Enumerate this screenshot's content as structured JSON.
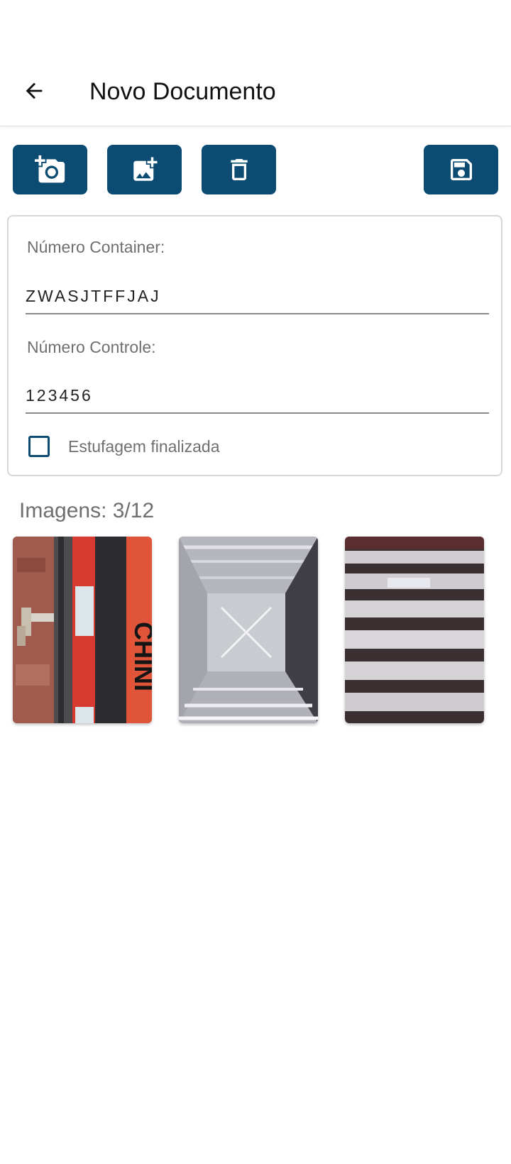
{
  "header": {
    "title": "Novo Documento",
    "back_icon": "arrow-back-icon"
  },
  "toolbar": {
    "color": "#0d4c72",
    "buttons": [
      {
        "icon": "add-camera-icon"
      },
      {
        "icon": "add-image-icon"
      },
      {
        "icon": "trash-icon"
      },
      {
        "icon": "save-icon"
      }
    ]
  },
  "form": {
    "container_label": "Número Container:",
    "container_value": "ZWASJTFFJAJ",
    "control_label": "Número Controle:",
    "control_value": "123456",
    "checkbox_label": "Estufagem finalizada",
    "checkbox_checked": false
  },
  "images": {
    "title": "Imagens: 3/12",
    "count": 3,
    "max": 12,
    "thumbnails": [
      {
        "name": "container-door-photo"
      },
      {
        "name": "container-interior-photo"
      },
      {
        "name": "container-ceiling-photo"
      }
    ]
  }
}
